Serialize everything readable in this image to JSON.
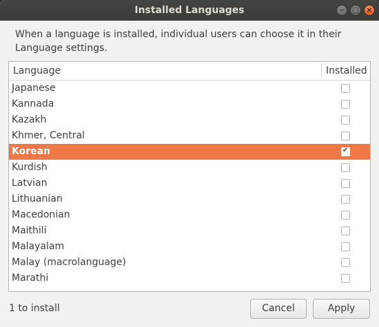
{
  "window": {
    "title": "Installed Languages"
  },
  "description": "When a language is installed, individual users can choose it in their Language settings.",
  "table": {
    "columns": {
      "language": "Language",
      "installed": "Installed"
    },
    "rows": [
      {
        "name": "Japanese",
        "installed": false,
        "selected": false
      },
      {
        "name": "Kannada",
        "installed": false,
        "selected": false
      },
      {
        "name": "Kazakh",
        "installed": false,
        "selected": false
      },
      {
        "name": "Khmer, Central",
        "installed": false,
        "selected": false
      },
      {
        "name": "Korean",
        "installed": true,
        "selected": true
      },
      {
        "name": "Kurdish",
        "installed": false,
        "selected": false
      },
      {
        "name": "Latvian",
        "installed": false,
        "selected": false
      },
      {
        "name": "Lithuanian",
        "installed": false,
        "selected": false
      },
      {
        "name": "Macedonian",
        "installed": false,
        "selected": false
      },
      {
        "name": "Maithili",
        "installed": false,
        "selected": false
      },
      {
        "name": "Malayalam",
        "installed": false,
        "selected": false
      },
      {
        "name": "Malay (macrolanguage)",
        "installed": false,
        "selected": false
      },
      {
        "name": "Marathi",
        "installed": false,
        "selected": false
      }
    ]
  },
  "footer": {
    "status": "1 to install",
    "cancel_label": "Cancel",
    "apply_label": "Apply"
  },
  "colors": {
    "accent": "#f07746",
    "titlebar": "#3c3b37",
    "background": "#f2f1f0"
  }
}
